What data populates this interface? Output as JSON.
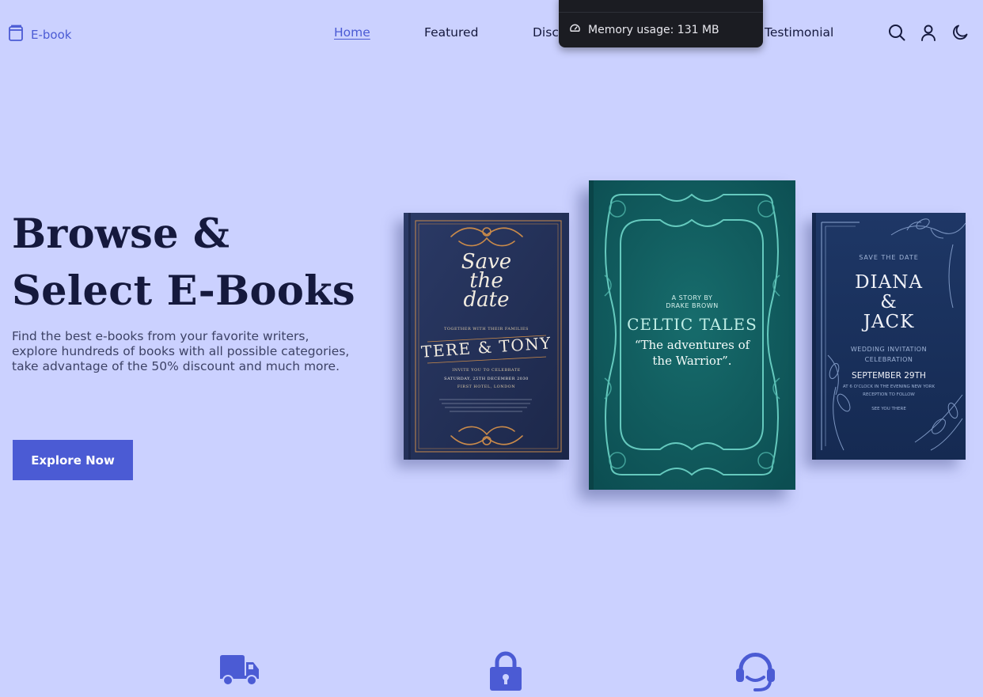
{
  "header": {
    "logo_text": "E-book",
    "nav": [
      {
        "label": "Home",
        "active": true
      },
      {
        "label": "Featured",
        "active": false
      },
      {
        "label": "Disco",
        "active": false
      },
      {
        "label": "Testimonial",
        "active": false
      }
    ],
    "icons": [
      "search-icon",
      "user-icon",
      "moon-icon"
    ]
  },
  "tooltip": {
    "top_text": "",
    "memory_label": "Memory usage: 131 MB",
    "icon": "gauge-icon"
  },
  "hero": {
    "title_line1": "Browse &",
    "title_line2": "Select E-Books",
    "description": "Find the best e-books from your favorite writers, explore hundreds of books with all possible categories, take advantage of the 50% discount and much more.",
    "cta_label": "Explore Now"
  },
  "books": {
    "book1": {
      "script_line1": "Save",
      "script_line2": "the",
      "script_line3": "date",
      "together": "TOGETHER WITH THEIR FAMILIES",
      "names": "TERE & TONY",
      "invite": "INVITE YOU TO CELEBRATE",
      "date": "SATURDAY, 25TH DECEMBER 2030",
      "venue": "FIRST HOTEL, LONDON"
    },
    "book2": {
      "by_line1": "A STORY BY",
      "by_line2": "DRAKE BROWN",
      "title": "CELTIC TALES",
      "subtitle_line1": "“The adventures of",
      "subtitle_line2": "the Warrior”."
    },
    "book3": {
      "save": "SAVE THE DATE",
      "name1": "DIANA",
      "amp": "&",
      "name2": "JACK",
      "invitation": "WEDDING INVITATION",
      "celebration": "CELEBRATION",
      "date": "SEPTEMBER 29TH",
      "time": "AT 6 O'CLOCK IN THE EVENING NEW YORK",
      "reception": "RECEPTION TO FOLLOW",
      "see_you": "SEE YOU THERE"
    }
  },
  "features": {
    "icons": [
      "truck-icon",
      "lock-icon",
      "headset-icon"
    ]
  },
  "colors": {
    "background": "#cbd1ff",
    "accent": "#4b5bd4",
    "title": "#15193d"
  }
}
